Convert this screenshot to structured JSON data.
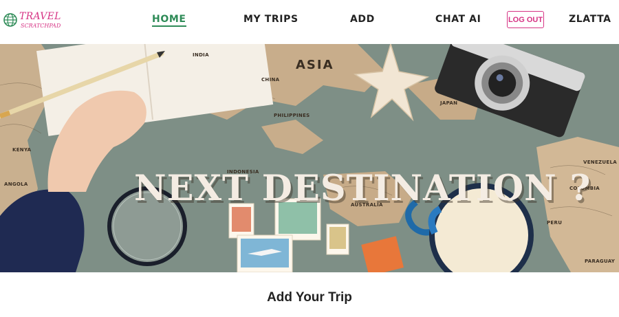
{
  "brand": {
    "line1": "TRAVEL",
    "line2": "SCRATCHPAD"
  },
  "nav": {
    "home": "HOME",
    "my_trips": "MY TRIPS",
    "add": "ADD",
    "chat_ai": "CHAT AI",
    "logout": "LOG OUT",
    "user": "ZLATTA"
  },
  "hero": {
    "headline": "NEXT DESTINATION ?",
    "map_labels": {
      "asia": "ASIA",
      "philippines": "PHILIPPINES",
      "indonesia": "INDONESIA",
      "australia": "AUSTRALIA",
      "colombia": "COLOMBIA",
      "venezuela": "VENEZUELA",
      "peru": "PERU",
      "paraguay": "PARAGUAY",
      "india": "INDIA",
      "china": "CHINA",
      "japan": "JAPAN",
      "kenya": "KENYA",
      "angola": "ANGOLA"
    }
  },
  "section": {
    "title": "Add Your Trip"
  },
  "colors": {
    "accent_green": "#2e8b57",
    "accent_pink": "#d63384"
  }
}
